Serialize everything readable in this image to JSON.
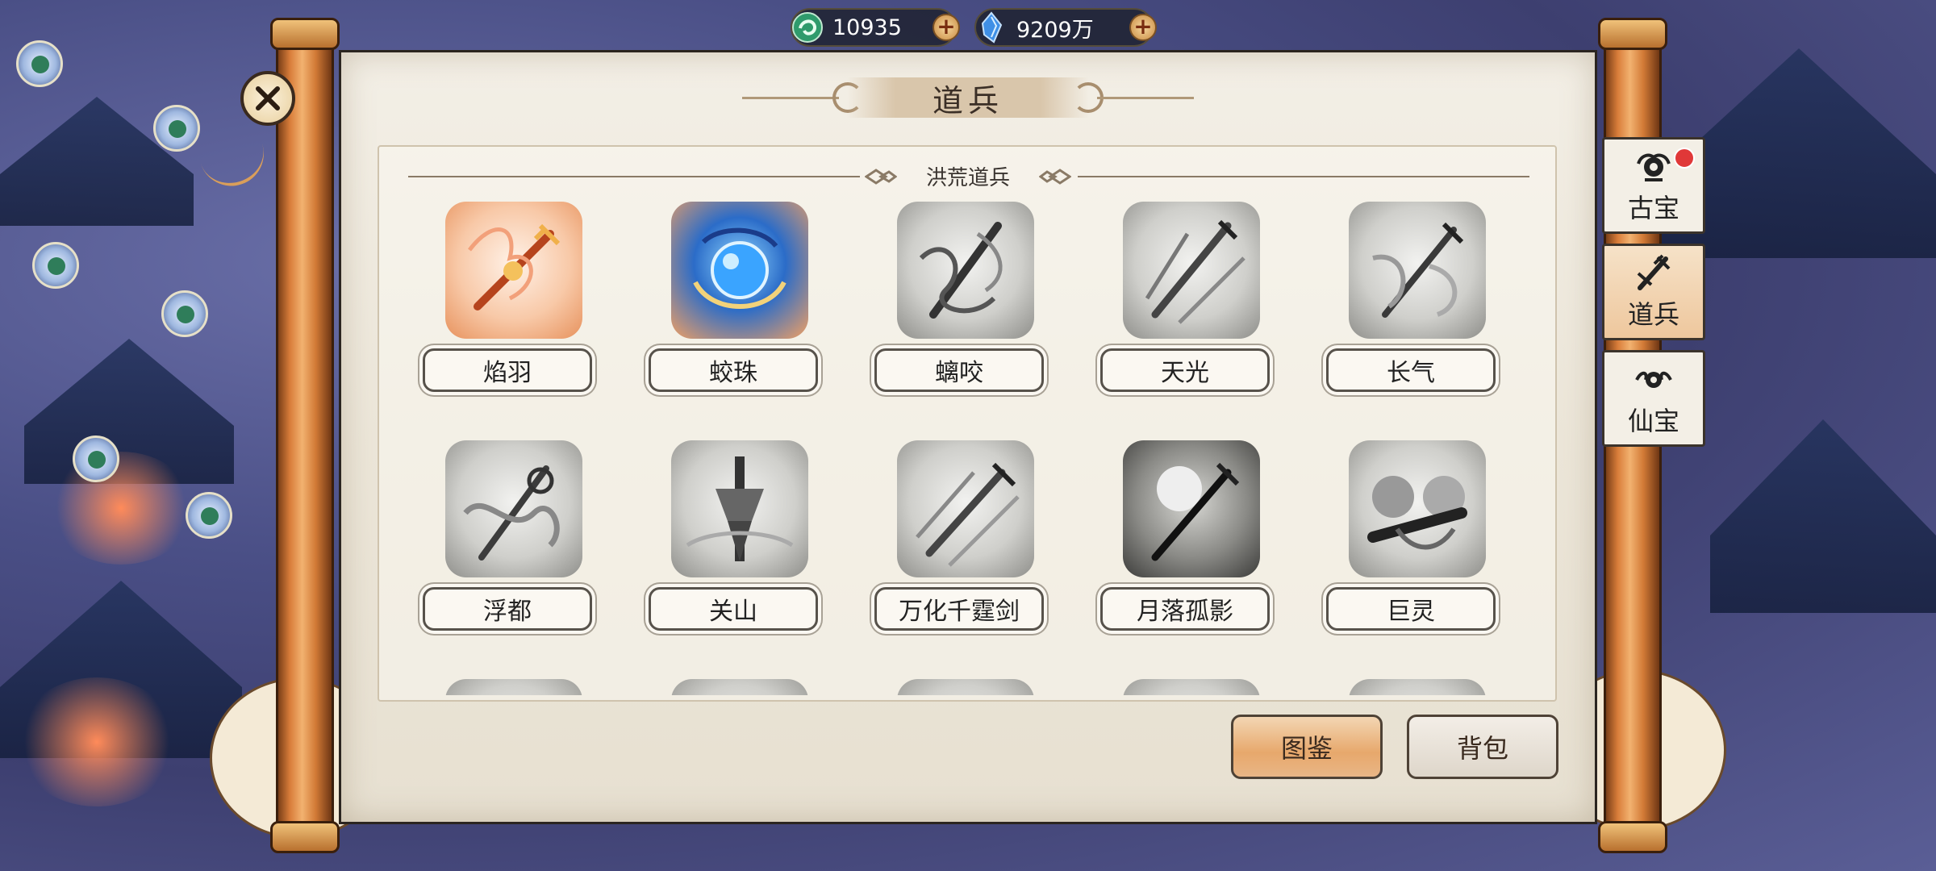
{
  "currency": [
    {
      "icon": "jade-coin-icon",
      "value": "10935",
      "color": "#3fc08a"
    },
    {
      "icon": "blue-crystal-icon",
      "value": "9209万",
      "color": "#4a9be8"
    }
  ],
  "panel": {
    "title": "道兵",
    "subtitle": "洪荒道兵"
  },
  "items": [
    {
      "name": "焰羽",
      "state": "owned",
      "theme": "fire"
    },
    {
      "name": "蛟珠",
      "state": "owned",
      "theme": "blue"
    },
    {
      "name": "螭咬",
      "state": "locked",
      "theme": "gray"
    },
    {
      "name": "天光",
      "state": "locked",
      "theme": "gray"
    },
    {
      "name": "长气",
      "state": "locked",
      "theme": "gray"
    },
    {
      "name": "浮都",
      "state": "locked",
      "theme": "gray"
    },
    {
      "name": "关山",
      "state": "locked",
      "theme": "gray"
    },
    {
      "name": "万化千霆剑",
      "state": "locked",
      "theme": "gray"
    },
    {
      "name": "月落孤影",
      "state": "locked",
      "theme": "gray"
    },
    {
      "name": "巨灵",
      "state": "locked",
      "theme": "gray"
    }
  ],
  "buttons": {
    "catalog": "图鉴",
    "bag": "背包"
  },
  "tabs": [
    {
      "label": "古宝",
      "icon": "ancient-treasure-icon",
      "badge": true
    },
    {
      "label": "道兵",
      "icon": "weapon-icon",
      "active": true
    },
    {
      "label": "仙宝",
      "icon": "immortal-treasure-icon"
    }
  ]
}
